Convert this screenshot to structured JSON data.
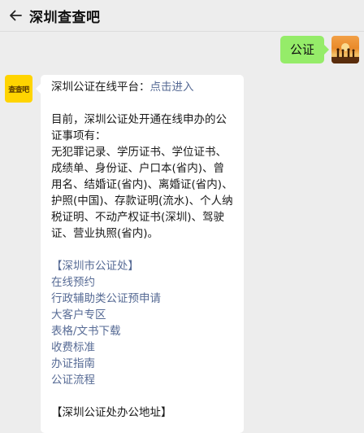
{
  "header": {
    "title": "深圳查查吧"
  },
  "outgoing": {
    "text": "公证"
  },
  "incoming": {
    "platform_label": "深圳公证在线平台：",
    "platform_link": "点击进入",
    "intro": "目前，深圳公证处开通在线申办的公证事项有：",
    "items_text": "无犯罪记录、学历证书、学位证书、成绩单、身份证、户口本(省内)、曾用名、结婚证(省内)、离婚证(省内)、护照(中国)、存款证明(流水)、个人纳税证明、不动产权证书(深圳)、驾驶证、营业执照(省内)。",
    "section1_header": "【深圳市公证处】",
    "links": [
      "在线预约",
      "行政辅助类公证预申请",
      "大客户专区",
      "表格/文书下载",
      "收费标准",
      "办证指南",
      "公证流程"
    ],
    "section2_header": "【深圳公证处办公地址】"
  },
  "bot_avatar_text": "查查吧",
  "colors": {
    "bubble_out": "#95ec69",
    "link": "#576b95",
    "background": "#ededed"
  },
  "icons": {
    "back": "back-arrow-icon"
  }
}
